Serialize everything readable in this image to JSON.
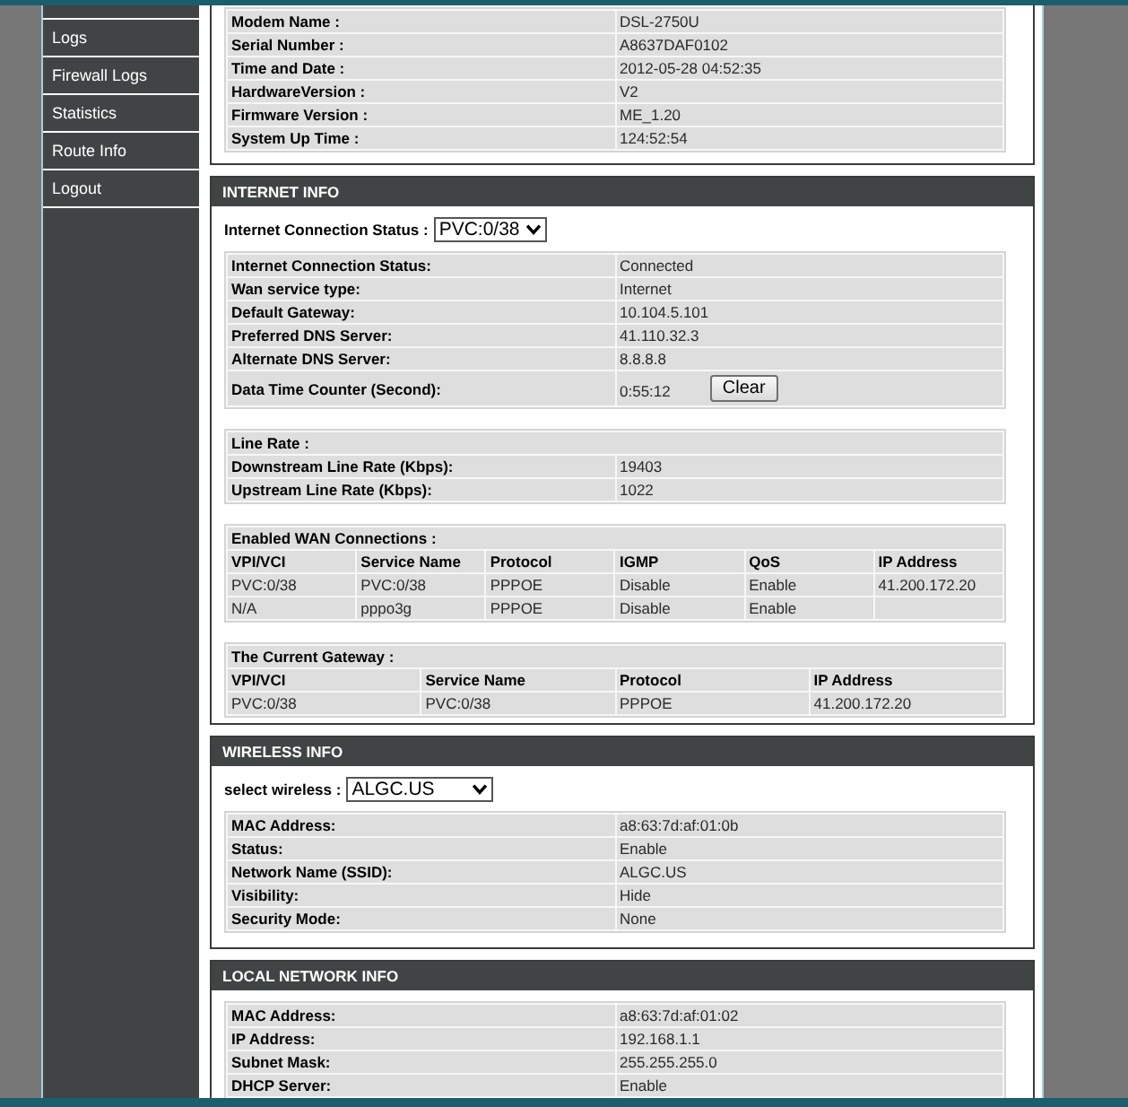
{
  "sidebar": {
    "items": [
      "Logs",
      "Firewall Logs",
      "Statistics",
      "Route Info",
      "Logout"
    ]
  },
  "sections": [
    {
      "tables": [
        {
          "kind": "pairs",
          "rows": [
            {
              "label": "Modem Name :",
              "value": "DSL-2750U"
            },
            {
              "label": "Serial Number :",
              "value": "A8637DAF0102"
            },
            {
              "label": "Time and Date :",
              "value": "2012-05-28 04:52:35"
            },
            {
              "label": "HardwareVersion :",
              "value": "V2"
            },
            {
              "label": "Firmware Version :",
              "value": "ME_1.20"
            },
            {
              "label": "System Up Time :",
              "value": "124:52:54"
            }
          ]
        }
      ]
    },
    {
      "title": "INTERNET INFO",
      "select": {
        "label": "Internet Connection Status :",
        "value": "PVC:0/38"
      },
      "tables": [
        {
          "kind": "pairs",
          "rows": [
            {
              "label": "Internet Connection Status:",
              "value": "Connected"
            },
            {
              "label": "Wan service type:",
              "value": "Internet"
            },
            {
              "label": "Default Gateway:",
              "value": "10.104.5.101"
            },
            {
              "label": "Preferred DNS Server:",
              "value": "41.110.32.3"
            },
            {
              "label": "Alternate DNS Server:",
              "value": "8.8.8.8"
            },
            {
              "label": "Data Time Counter (Second):",
              "value": "0:55:12",
              "button": "Clear"
            }
          ]
        },
        {
          "kind": "pairs",
          "title": "Line Rate :",
          "rows": [
            {
              "label": "Downstream Line Rate (Kbps):",
              "value": "19403"
            },
            {
              "label": "Upstream Line Rate (Kbps):",
              "value": "1022"
            }
          ]
        },
        {
          "kind": "grid",
          "title": "Enabled WAN Connections :",
          "columns": [
            "VPI/VCI",
            "Service Name",
            "Protocol",
            "IGMP",
            "QoS",
            "IP Address"
          ],
          "rows": [
            [
              "PVC:0/38",
              "PVC:0/38",
              "PPPOE",
              "Disable",
              "Enable",
              "41.200.172.20"
            ],
            [
              "N/A",
              "pppo3g",
              "PPPOE",
              "Disable",
              "Enable"
            ]
          ]
        },
        {
          "kind": "grid",
          "title": "The Current Gateway :",
          "columns": [
            "VPI/VCI",
            "Service Name",
            "Protocol",
            "IP Address"
          ],
          "rows": [
            [
              "PVC:0/38",
              "PVC:0/38",
              "PPPOE",
              "41.200.172.20"
            ]
          ]
        }
      ]
    },
    {
      "title": "WIRELESS INFO",
      "select": {
        "label": "select wireless :",
        "value": "ALGC.US"
      },
      "tables": [
        {
          "kind": "pairs",
          "rows": [
            {
              "label": "MAC Address:",
              "value": "a8:63:7d:af:01:0b"
            },
            {
              "label": "Status:",
              "value": "Enable"
            },
            {
              "label": "Network Name (SSID):",
              "value": "ALGC.US"
            },
            {
              "label": "Visibility:",
              "value": "Hide"
            },
            {
              "label": "Security Mode:",
              "value": "None"
            }
          ]
        }
      ]
    },
    {
      "title": "LOCAL NETWORK INFO",
      "tables": [
        {
          "kind": "pairs",
          "rows": [
            {
              "label": "MAC Address:",
              "value": "a8:63:7d:af:01:02"
            },
            {
              "label": "IP Address:",
              "value": "192.168.1.1"
            },
            {
              "label": "Subnet Mask:",
              "value": "255.255.255.0"
            },
            {
              "label": "DHCP Server:",
              "value": "Enable"
            }
          ]
        }
      ]
    }
  ]
}
